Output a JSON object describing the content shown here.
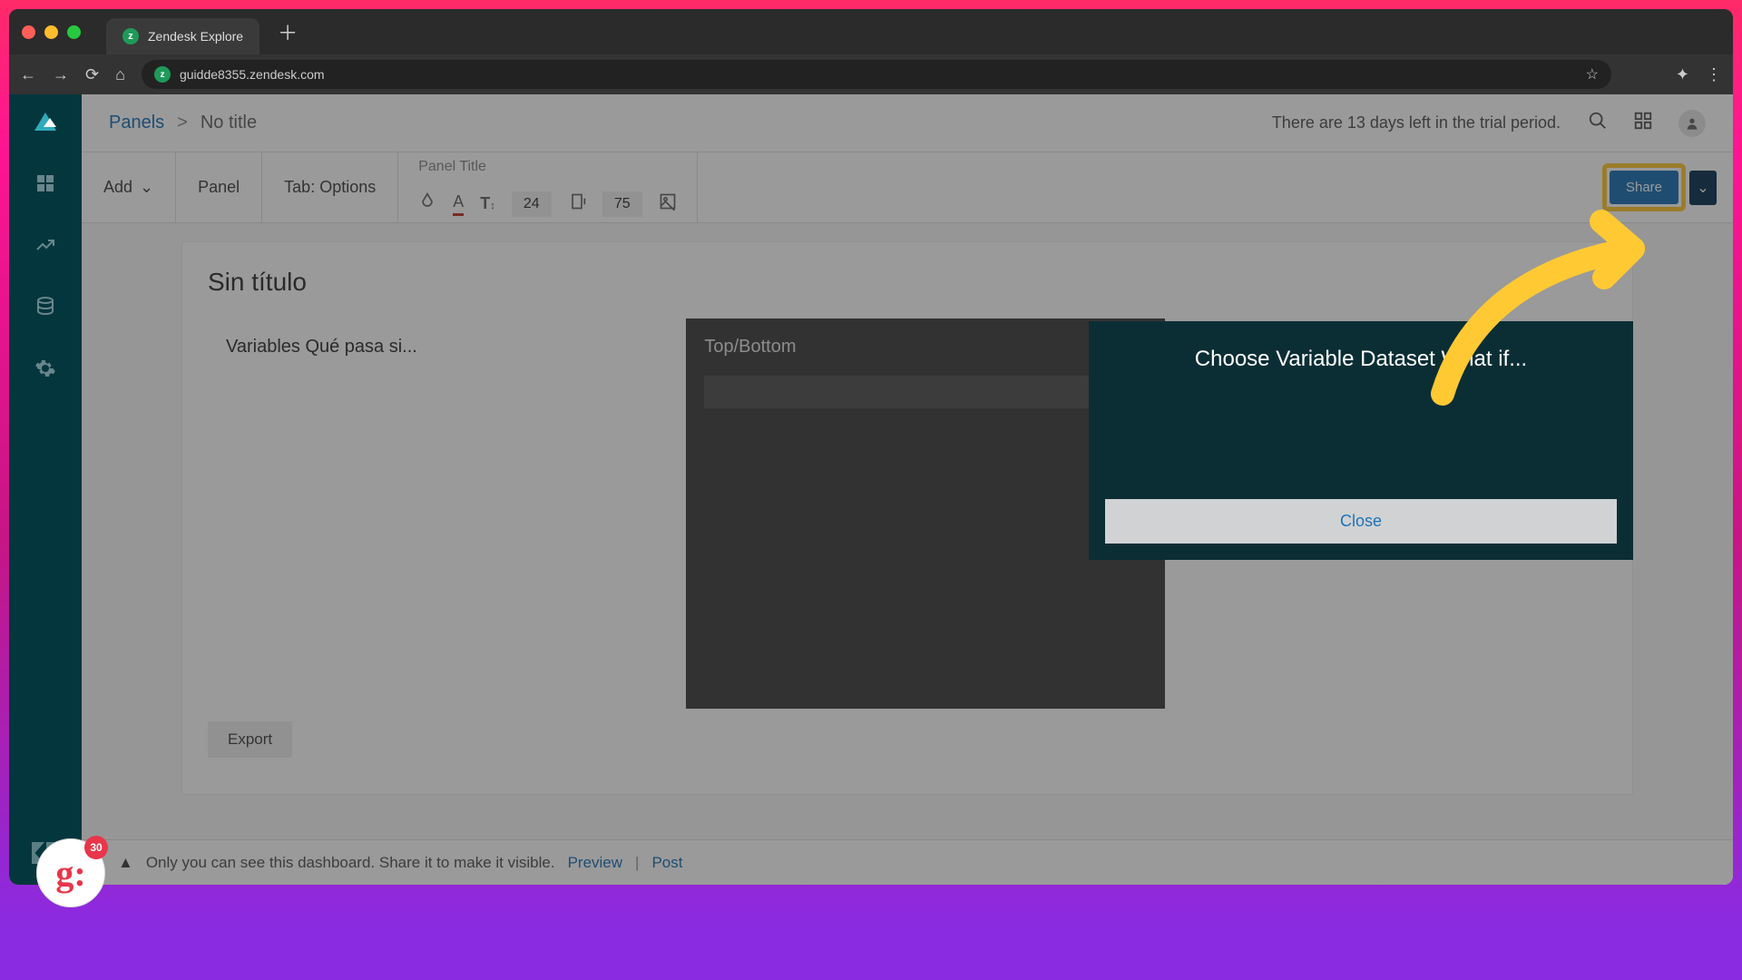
{
  "browser": {
    "tab_title": "Zendesk Explore",
    "url": "guidde8355.zendesk.com"
  },
  "topbar": {
    "breadcrumb_root": "Panels",
    "breadcrumb_sep": ">",
    "breadcrumb_current": "No title",
    "trial_notice": "There are 13 days left in the trial period."
  },
  "toolbar": {
    "add_label": "Add",
    "panel_label": "Panel",
    "tab_label": "Tab: Options",
    "panel_title_label": "Panel Title",
    "font_size": "24",
    "width_value": "75",
    "share_label": "Share"
  },
  "dashboard": {
    "title": "Sin título",
    "panel_left_header": "Variables Qué pasa si...",
    "panel_mid_header": "Top/Bottom",
    "export_label": "Export"
  },
  "modal": {
    "title": "Choose Variable Dataset What if...",
    "close_label": "Close"
  },
  "bottombar": {
    "message": "Only you can see this dashboard. Share it to make it visible.",
    "preview_label": "Preview",
    "post_label": "Post"
  },
  "guide_badge": {
    "count": "30"
  }
}
